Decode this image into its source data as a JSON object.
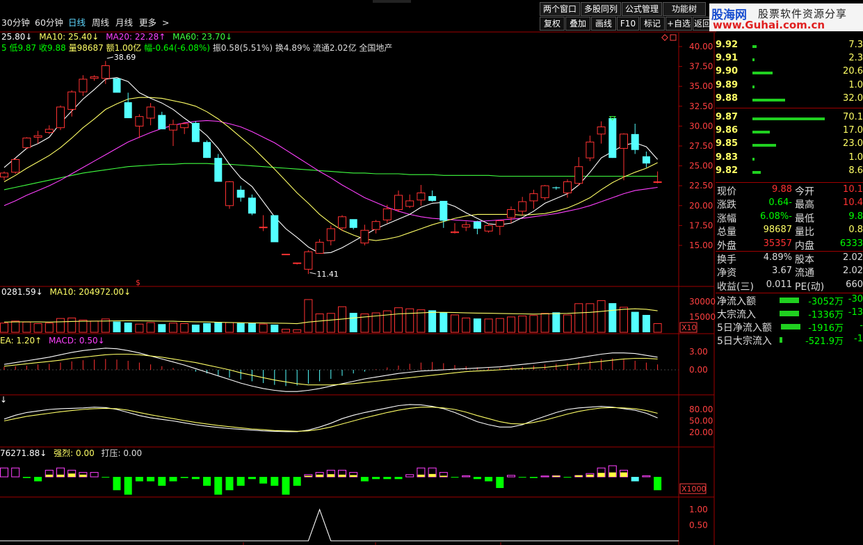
{
  "toolbar": {
    "periods": [
      "30分钟",
      "60分钟",
      "日线",
      "周线",
      "月线",
      "更多",
      ">"
    ],
    "active_period": "日线",
    "top_buttons": [
      "两个窗口",
      "多股同列",
      "公式管理",
      "功能树"
    ],
    "tool_buttons": [
      "复权",
      "叠加",
      "画线",
      "F10",
      "标记",
      "+自选",
      "返回"
    ]
  },
  "logo": {
    "title": "股海网",
    "subtitle": "股票软件资源分享",
    "url": "www.Guhai.com.cn"
  },
  "colors": {
    "up": "#ff3232",
    "down": "#54ffff",
    "ma5": "#ffffff",
    "ma10": "#ffff66",
    "ma20": "#ff40ff",
    "ma60": "#40ff40",
    "axis": "#a00000",
    "green": "#00ff00"
  },
  "main_legend": {
    "ma5": "25.80↓",
    "ma10_label": "MA10: 25.40↓",
    "ma20_label": "MA20: 22.28↑",
    "ma60_label": "MA60: 23.70↓"
  },
  "info_line": {
    "low": "5 低9.87",
    "close": "收9.88",
    "volume": "量98687",
    "amount": "额1.00亿",
    "change": "幅-0.64(-6.08%)",
    "amplitude": "振0.58(5.51%)",
    "turnover": "换4.89%",
    "float": "流通2.02亿",
    "sector": "全国地产"
  },
  "price_axis": [
    "40.00",
    "37.50",
    "35.00",
    "32.50",
    "30.00",
    "27.50",
    "25.00",
    "22.50",
    "20.00",
    "17.50",
    "15.00"
  ],
  "annotations": {
    "high": "38.69",
    "low": "11.41",
    "dollar": "$"
  },
  "volume_legend": {
    "a": "0281.59↓",
    "b": "MA10: 204972.00↓"
  },
  "volume_axis": [
    "30000",
    "15000"
  ],
  "volume_unit": "X10",
  "macd_legend": {
    "dea": "EA: 1.20↑",
    "macd": "MACD: 0.50↓"
  },
  "macd_axis": [
    "3.00",
    "0.00"
  ],
  "kdj_legend": "↓",
  "kdj_axis": [
    "80.00",
    "50.00",
    "20.00"
  ],
  "flow_legend": {
    "a": "76271.88↓",
    "b": "强烈: 0.00",
    "c": "打压: 0.00"
  },
  "flow_unit": "X1000",
  "signal_axis": [
    "1.00",
    "0.50"
  ],
  "order_book": [
    {
      "price": "9.92",
      "bar": 0.06,
      "qty": "7.3"
    },
    {
      "price": "9.91",
      "bar": 0.02,
      "qty": "2.3"
    },
    {
      "price": "9.90",
      "bar": 0.28,
      "qty": "20.6"
    },
    {
      "price": "9.89",
      "bar": 0.02,
      "qty": "1.0"
    },
    {
      "price": "9.88",
      "bar": 0.45,
      "qty": "32.0"
    },
    {
      "price": "9.87",
      "bar": 1.0,
      "qty": "70.1"
    },
    {
      "price": "9.86",
      "bar": 0.24,
      "qty": "17.0"
    },
    {
      "price": "9.85",
      "bar": 0.33,
      "qty": "23.0"
    },
    {
      "price": "9.83",
      "bar": 0.02,
      "qty": "1.0"
    },
    {
      "price": "9.82",
      "bar": 0.12,
      "qty": "8.6"
    }
  ],
  "quote": [
    {
      "l1": "现价",
      "v1": "9.88",
      "c1": "#ff3232",
      "l2": "今开",
      "v2": "10.1",
      "c2": "#ff3232"
    },
    {
      "l1": "涨跌",
      "v1": "-0.64",
      "c1": "#00ff00",
      "l2": "最高",
      "v2": "10.4",
      "c2": "#ff3232"
    },
    {
      "l1": "涨幅",
      "v1": "-6.08%",
      "c1": "#00ff00",
      "l2": "最低",
      "v2": "9.8",
      "c2": "#00ff00"
    },
    {
      "l1": "总量",
      "v1": "98687",
      "c1": "#ffff66",
      "l2": "量比",
      "v2": "0.8",
      "c2": "#ffff66"
    },
    {
      "l1": "外盘",
      "v1": "35357",
      "c1": "#ff3232",
      "l2": "内盘",
      "v2": "6333",
      "c2": "#00ff00"
    }
  ],
  "quote2": [
    {
      "l1": "换手",
      "v1": "4.89%",
      "l2": "股本",
      "v2": "2.02"
    },
    {
      "l1": "净资",
      "v1": "3.67",
      "l2": "流通",
      "v2": "2.02"
    },
    {
      "l1": "收益(三)",
      "v1": "0.011",
      "l2": "PE(动)",
      "v2": "660"
    }
  ],
  "flows": [
    {
      "label": "净流入额",
      "value": "-3052万",
      "extra": "-30"
    },
    {
      "label": "大宗流入",
      "value": "-1336万",
      "extra": "-13"
    },
    {
      "label": "5日净流入额",
      "value": "-1916万",
      "extra": "-"
    },
    {
      "label": "5日大宗流入",
      "value": "-521.9万",
      "extra": "-1"
    }
  ],
  "candles": [
    [
      23.6,
      24.3,
      23.2,
      24.1
    ],
    [
      24.2,
      26.0,
      24.0,
      25.8
    ],
    [
      27.3,
      28.6,
      27.1,
      28.5
    ],
    [
      28.6,
      29.4,
      27.8,
      28.8
    ],
    [
      29.2,
      30.1,
      29.0,
      29.6
    ],
    [
      29.8,
      32.6,
      29.5,
      32.4
    ],
    [
      32.1,
      34.5,
      31.2,
      34.3
    ],
    [
      34.3,
      36.4,
      33.8,
      35.9
    ],
    [
      36.0,
      36.4,
      35.7,
      36.2
    ],
    [
      36.0,
      38.2,
      35.3,
      37.6
    ],
    [
      36.0,
      35.8,
      34.5,
      34.2
    ],
    [
      33.0,
      34.2,
      31.0,
      31.0
    ],
    [
      30.0,
      31.5,
      28.5,
      31.2
    ],
    [
      31.0,
      32.9,
      30.1,
      32.4
    ],
    [
      31.4,
      31.8,
      30.0,
      29.6
    ],
    [
      29.5,
      30.8,
      27.5,
      30.2
    ],
    [
      29.8,
      30.5,
      29.0,
      30.3
    ],
    [
      30.4,
      30.6,
      28.0,
      28.0
    ],
    [
      28.0,
      28.2,
      26.0,
      26.0
    ],
    [
      26.0,
      26.5,
      23.0,
      23.0
    ],
    [
      20.0,
      23.1,
      19.6,
      23.0
    ],
    [
      22.0,
      22.5,
      20.5,
      21.0
    ],
    [
      21.0,
      21.4,
      18.8,
      19.0
    ],
    [
      17.3,
      18.8,
      16.8,
      17.3
    ],
    [
      18.8,
      18.8,
      15.6,
      15.4
    ],
    [
      13.9,
      13.9,
      13.8,
      13.9
    ],
    [
      12.8,
      12.8,
      12.6,
      12.8
    ],
    [
      12.0,
      14.4,
      11.4,
      14.2
    ],
    [
      14.0,
      15.8,
      14.2,
      15.4
    ],
    [
      15.6,
      17.5,
      15.0,
      17.1
    ],
    [
      17.2,
      18.8,
      16.8,
      18.6
    ],
    [
      18.3,
      18.2,
      17.0,
      17.2
    ],
    [
      15.3,
      17.6,
      15.0,
      16.9
    ],
    [
      17.0,
      18.2,
      16.5,
      18.0
    ],
    [
      18.2,
      20.1,
      17.8,
      19.6
    ],
    [
      19.5,
      21.9,
      19.2,
      21.3
    ],
    [
      19.9,
      21.4,
      19.7,
      20.6
    ],
    [
      20.7,
      22.6,
      20.0,
      21.6
    ],
    [
      21.2,
      21.9,
      20.5,
      20.6
    ],
    [
      20.6,
      20.5,
      17.2,
      18.1
    ],
    [
      16.6,
      17.8,
      16.5,
      16.7
    ],
    [
      17.3,
      18.0,
      16.8,
      17.6
    ],
    [
      18.0,
      18.1,
      16.4,
      17.1
    ],
    [
      16.8,
      17.8,
      16.6,
      17.5
    ],
    [
      17.4,
      18.2,
      16.3,
      18.1
    ],
    [
      18.5,
      19.9,
      17.8,
      19.5
    ],
    [
      19.3,
      21.1,
      18.8,
      20.5
    ],
    [
      20.6,
      22.0,
      19.6,
      21.5
    ],
    [
      21.0,
      22.6,
      20.7,
      22.5
    ],
    [
      22.3,
      22.4,
      22.0,
      22.2
    ],
    [
      21.6,
      23.3,
      21.0,
      23.0
    ],
    [
      22.8,
      26.1,
      22.5,
      24.9
    ],
    [
      26.0,
      28.8,
      25.6,
      28.0
    ],
    [
      29.0,
      30.6,
      27.8,
      29.9
    ],
    [
      31.0,
      31.0,
      26.0,
      26.0
    ],
    [
      27.2,
      29.1,
      23.2,
      29.0
    ],
    [
      29.0,
      30.3,
      26.5,
      27.0
    ],
    [
      26.2,
      26.8,
      24.8,
      25.3
    ],
    [
      23.0,
      24.3,
      22.8,
      23.0
    ]
  ],
  "ma5": [
    24.8,
    26.0,
    27.2,
    27.8,
    28.6,
    30.4,
    31.9,
    33.4,
    34.6,
    35.9,
    36.1,
    35.6,
    34.2,
    33.5,
    32.9,
    32.1,
    31.0,
    30.0,
    28.8,
    27.2,
    25.2,
    23.5,
    22.4,
    20.5,
    18.6,
    17.1,
    16.0,
    14.8,
    14.0,
    14.1,
    14.7,
    15.5,
    16.3,
    17.1,
    17.7,
    18.3,
    18.9,
    19.8,
    20.3,
    20.4,
    19.9,
    19.1,
    18.4,
    17.7,
    17.6,
    17.8,
    18.5,
    19.3,
    20.3,
    20.9,
    21.5,
    22.6,
    24.2,
    26.0,
    26.8,
    27.6,
    27.9,
    27.4,
    25.8
  ],
  "ma10": [
    23.0,
    23.8,
    24.7,
    25.5,
    26.3,
    27.3,
    28.5,
    29.8,
    30.9,
    32.1,
    32.8,
    33.4,
    33.6,
    33.6,
    33.5,
    33.2,
    32.9,
    32.5,
    31.8,
    30.9,
    29.8,
    28.6,
    27.4,
    26.0,
    24.6,
    23.1,
    21.6,
    20.3,
    18.9,
    17.8,
    16.9,
    16.3,
    15.8,
    15.6,
    15.8,
    16.1,
    16.6,
    17.1,
    17.6,
    18.0,
    18.4,
    18.7,
    18.9,
    18.9,
    18.9,
    18.9,
    18.8,
    18.9,
    19.0,
    19.3,
    19.7,
    20.3,
    21.0,
    22.0,
    22.9,
    23.6,
    24.2,
    24.7,
    25.4
  ],
  "ma20": [
    20.0,
    20.6,
    21.3,
    21.9,
    22.5,
    23.2,
    24.0,
    24.8,
    25.6,
    26.4,
    27.2,
    28.0,
    28.6,
    29.2,
    29.7,
    30.1,
    30.4,
    30.6,
    30.7,
    30.6,
    30.3,
    29.9,
    29.3,
    28.6,
    27.9,
    27.0,
    26.1,
    25.2,
    24.3,
    23.5,
    22.6,
    21.8,
    21.0,
    20.4,
    19.8,
    19.3,
    18.9,
    18.6,
    18.4,
    18.3,
    18.2,
    18.1,
    18.0,
    18.1,
    18.2,
    18.3,
    18.4,
    18.6,
    18.8,
    19.0,
    19.3,
    19.6,
    20.0,
    20.5,
    21.0,
    21.5,
    21.9,
    22.1,
    22.3
  ],
  "ma60": [
    22.0,
    22.3,
    22.6,
    22.9,
    23.2,
    23.5,
    23.8,
    24.1,
    24.3,
    24.5,
    24.7,
    24.9,
    25.0,
    25.1,
    25.2,
    25.2,
    25.3,
    25.3,
    25.3,
    25.2,
    25.2,
    25.1,
    25.0,
    24.9,
    24.8,
    24.7,
    24.6,
    24.5,
    24.4,
    24.3,
    24.2,
    24.1,
    24.1,
    24.0,
    24.0,
    24.0,
    23.9,
    23.9,
    23.9,
    23.8,
    23.8,
    23.8,
    23.8,
    23.8,
    23.7,
    23.7,
    23.7,
    23.7,
    23.7,
    23.7,
    23.7,
    23.7,
    23.7,
    23.7,
    23.7,
    23.7,
    23.7,
    23.7,
    23.7
  ],
  "volume": [
    9000,
    11000,
    10000,
    8500,
    9000,
    13500,
    14000,
    12000,
    11000,
    13000,
    10500,
    9500,
    8000,
    9500,
    8000,
    9000,
    8500,
    7500,
    9000,
    10000,
    9500,
    9000,
    9500,
    8000,
    7500,
    3000,
    2500,
    32000,
    18000,
    18500,
    25000,
    19000,
    18000,
    19000,
    21000,
    24000,
    23000,
    22000,
    21500,
    19500,
    17000,
    14000,
    13500,
    13000,
    13500,
    15000,
    16000,
    16500,
    18500,
    19500,
    17000,
    28000,
    28000,
    31000,
    28500,
    24500,
    20000,
    17000,
    8500
  ],
  "vol_ma": [
    10000,
    10100,
    10200,
    10100,
    10000,
    10300,
    10600,
    10800,
    10900,
    11000,
    11200,
    11300,
    11200,
    11100,
    10900,
    10800,
    10500,
    10300,
    10100,
    9800,
    9600,
    9400,
    9200,
    9100,
    9000,
    8800,
    8400,
    10000,
    11000,
    12000,
    13000,
    14000,
    15000,
    16000,
    17000,
    18000,
    18500,
    19000,
    19500,
    19500,
    19300,
    19000,
    18800,
    18600,
    18400,
    18200,
    18000,
    17800,
    18000,
    18300,
    18500,
    19000,
    19500,
    20500,
    21500,
    22500,
    23000,
    22500,
    21000
  ],
  "macd_bars": [
    0.5,
    0.6,
    0.7,
    0.9,
    1.0,
    1.2,
    1.4,
    1.6,
    1.7,
    1.8,
    1.7,
    1.5,
    1.2,
    0.9,
    0.6,
    0.3,
    0.0,
    -0.3,
    -0.6,
    -0.9,
    -1.3,
    -1.6,
    -1.9,
    -2.2,
    -2.5,
    -2.7,
    -2.6,
    -2.3,
    -1.9,
    -1.5,
    -1.0,
    -0.6,
    -0.3,
    0.1,
    0.4,
    0.7,
    1.0,
    1.2,
    1.3,
    1.1,
    0.8,
    0.6,
    0.4,
    0.3,
    0.3,
    0.4,
    0.5,
    0.7,
    0.9,
    1.0,
    1.1,
    1.3,
    1.5,
    1.8,
    1.9,
    1.7,
    1.5,
    1.2,
    0.9
  ],
  "dif": [
    0.9,
    1.2,
    1.5,
    1.8,
    2.1,
    2.5,
    2.9,
    3.2,
    3.4,
    3.6,
    3.5,
    3.2,
    2.8,
    2.3,
    1.8,
    1.3,
    0.8,
    0.2,
    -0.4,
    -1.0,
    -1.6,
    -2.2,
    -2.7,
    -3.1,
    -3.4,
    -3.6,
    -3.6,
    -3.4,
    -3.1,
    -2.7,
    -2.3,
    -1.9,
    -1.5,
    -1.2,
    -0.9,
    -0.6,
    -0.4,
    -0.2,
    -0.1,
    0.0,
    0.1,
    0.2,
    0.3,
    0.4,
    0.5,
    0.7,
    0.9,
    1.1,
    1.3,
    1.5,
    1.7,
    2.0,
    2.3,
    2.6,
    2.8,
    2.8,
    2.7,
    2.4,
    2.1
  ],
  "dea": [
    0.6,
    0.8,
    1.0,
    1.2,
    1.4,
    1.6,
    1.9,
    2.1,
    2.3,
    2.5,
    2.6,
    2.6,
    2.5,
    2.3,
    2.1,
    1.8,
    1.5,
    1.2,
    0.8,
    0.4,
    0.0,
    -0.5,
    -0.9,
    -1.3,
    -1.7,
    -2.0,
    -2.3,
    -2.5,
    -2.5,
    -2.5,
    -2.4,
    -2.3,
    -2.1,
    -1.9,
    -1.7,
    -1.5,
    -1.3,
    -1.1,
    -0.9,
    -0.7,
    -0.5,
    -0.3,
    -0.2,
    -0.1,
    0.0,
    0.1,
    0.2,
    0.3,
    0.4,
    0.6,
    0.8,
    1.0,
    1.2,
    1.4,
    1.6,
    1.8,
    1.9,
    1.9,
    1.8
  ],
  "k": [
    55,
    65,
    72,
    76,
    80,
    82,
    83,
    84,
    86,
    85,
    80,
    72,
    64,
    58,
    54,
    50,
    45,
    40,
    36,
    33,
    30,
    28,
    26,
    24,
    23,
    22,
    22,
    26,
    34,
    44,
    56,
    65,
    72,
    78,
    84,
    90,
    93,
    92,
    88,
    82,
    72,
    60,
    48,
    40,
    34,
    34,
    40,
    52,
    62,
    72,
    80,
    84,
    86,
    88,
    86,
    82,
    78,
    70,
    58
  ],
  "d": [
    50,
    56,
    62,
    66,
    70,
    74,
    77,
    80,
    82,
    83,
    82,
    78,
    72,
    66,
    61,
    56,
    51,
    46,
    42,
    38,
    35,
    32,
    29,
    27,
    25,
    24,
    23,
    24,
    28,
    34,
    42,
    50,
    58,
    65,
    72,
    78,
    83,
    86,
    86,
    84,
    80,
    73,
    64,
    56,
    48,
    43,
    42,
    46,
    52,
    60,
    68,
    75,
    80,
    84,
    85,
    84,
    82,
    77,
    70
  ],
  "flow": [
    4,
    4,
    -0.5,
    -2,
    3,
    4,
    3,
    2,
    2,
    -0.3,
    -6,
    -8,
    -2,
    -2,
    -4,
    -2,
    -0.5,
    -1,
    -4,
    -8,
    -6,
    -4,
    -1,
    -3,
    -4,
    -8,
    -4,
    1,
    2,
    3,
    3,
    2,
    -2,
    -1,
    -1,
    -1,
    1,
    4,
    4,
    2,
    -0.3,
    0.5,
    -1,
    -2,
    -5,
    0.7,
    -0.3,
    -0.5,
    0.4,
    0.5,
    -0.3,
    0.6,
    1.5,
    4,
    5,
    3,
    -2,
    0.5,
    -6
  ],
  "flow_yellow": [
    0,
    0,
    0,
    0,
    1,
    1,
    1.5,
    1,
    0,
    0,
    0,
    0,
    0,
    0,
    0,
    0,
    0,
    0,
    0,
    0,
    0,
    0,
    0,
    0,
    0,
    0,
    0,
    0.5,
    1,
    1.2,
    1,
    0.8,
    0,
    0,
    0,
    0,
    0,
    1,
    1.3,
    0.5,
    0,
    0,
    0,
    0,
    0,
    0,
    0,
    0,
    0,
    0.5,
    0.5,
    0.7,
    1,
    1.8,
    2,
    2,
    0,
    0,
    0
  ],
  "signal_peak_index": 28
}
